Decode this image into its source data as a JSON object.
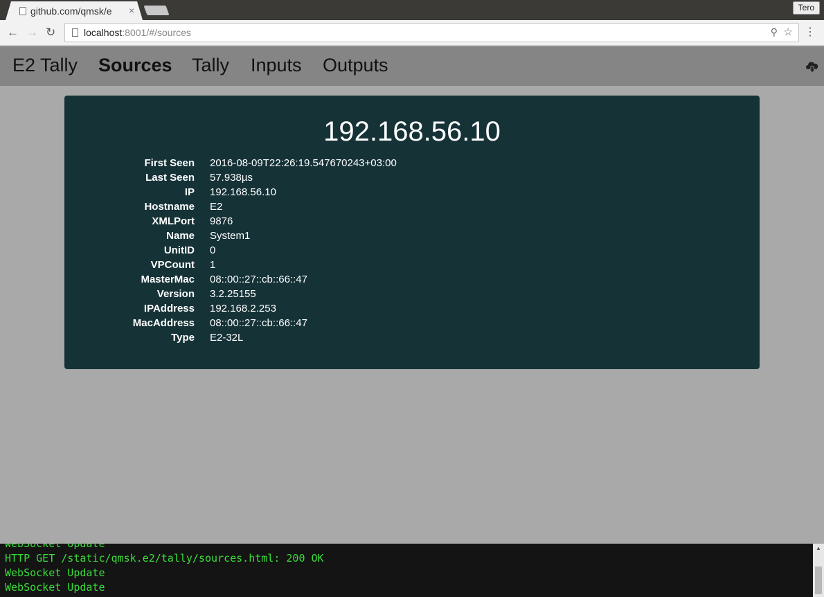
{
  "browser": {
    "tab_title": "github.com/qmsk/e",
    "tab_close": "×",
    "profile_name": "Tero",
    "url_host": "localhost",
    "url_rest": ":8001/#/sources"
  },
  "navbar": {
    "brand": "E2 Tally",
    "items": [
      {
        "label": "Sources",
        "active": true
      },
      {
        "label": "Tally"
      },
      {
        "label": "Inputs"
      },
      {
        "label": "Outputs"
      }
    ]
  },
  "source": {
    "title": "192.168.56.10",
    "fields": [
      {
        "key": "First Seen",
        "value": "2016-08-09T22:26:19.547670243+03:00"
      },
      {
        "key": "Last Seen",
        "value": "57.938µs"
      },
      {
        "key": "IP",
        "value": "192.168.56.10"
      },
      {
        "key": "Hostname",
        "value": "E2"
      },
      {
        "key": "XMLPort",
        "value": "9876"
      },
      {
        "key": "Name",
        "value": "System1"
      },
      {
        "key": "UnitID",
        "value": "0"
      },
      {
        "key": "VPCount",
        "value": "1"
      },
      {
        "key": "MasterMac",
        "value": "08::00::27::cb::66::47"
      },
      {
        "key": "Version",
        "value": "3.2.25155"
      },
      {
        "key": "IPAddress",
        "value": "192.168.2.253"
      },
      {
        "key": "MacAddress",
        "value": "08::00::27::cb::66::47"
      },
      {
        "key": "Type",
        "value": "E2-32L"
      }
    ]
  },
  "terminal": {
    "lines": [
      "WebSocket Update",
      "HTTP GET /static/qmsk.e2/tally/sources.html: 200 OK",
      "WebSocket Update",
      "WebSocket Update"
    ]
  },
  "colors": {
    "card_bg": "#153237",
    "navbar_bg": "#858585",
    "page_bg": "#a9a9a9",
    "terminal_text": "#3bdd3b"
  }
}
